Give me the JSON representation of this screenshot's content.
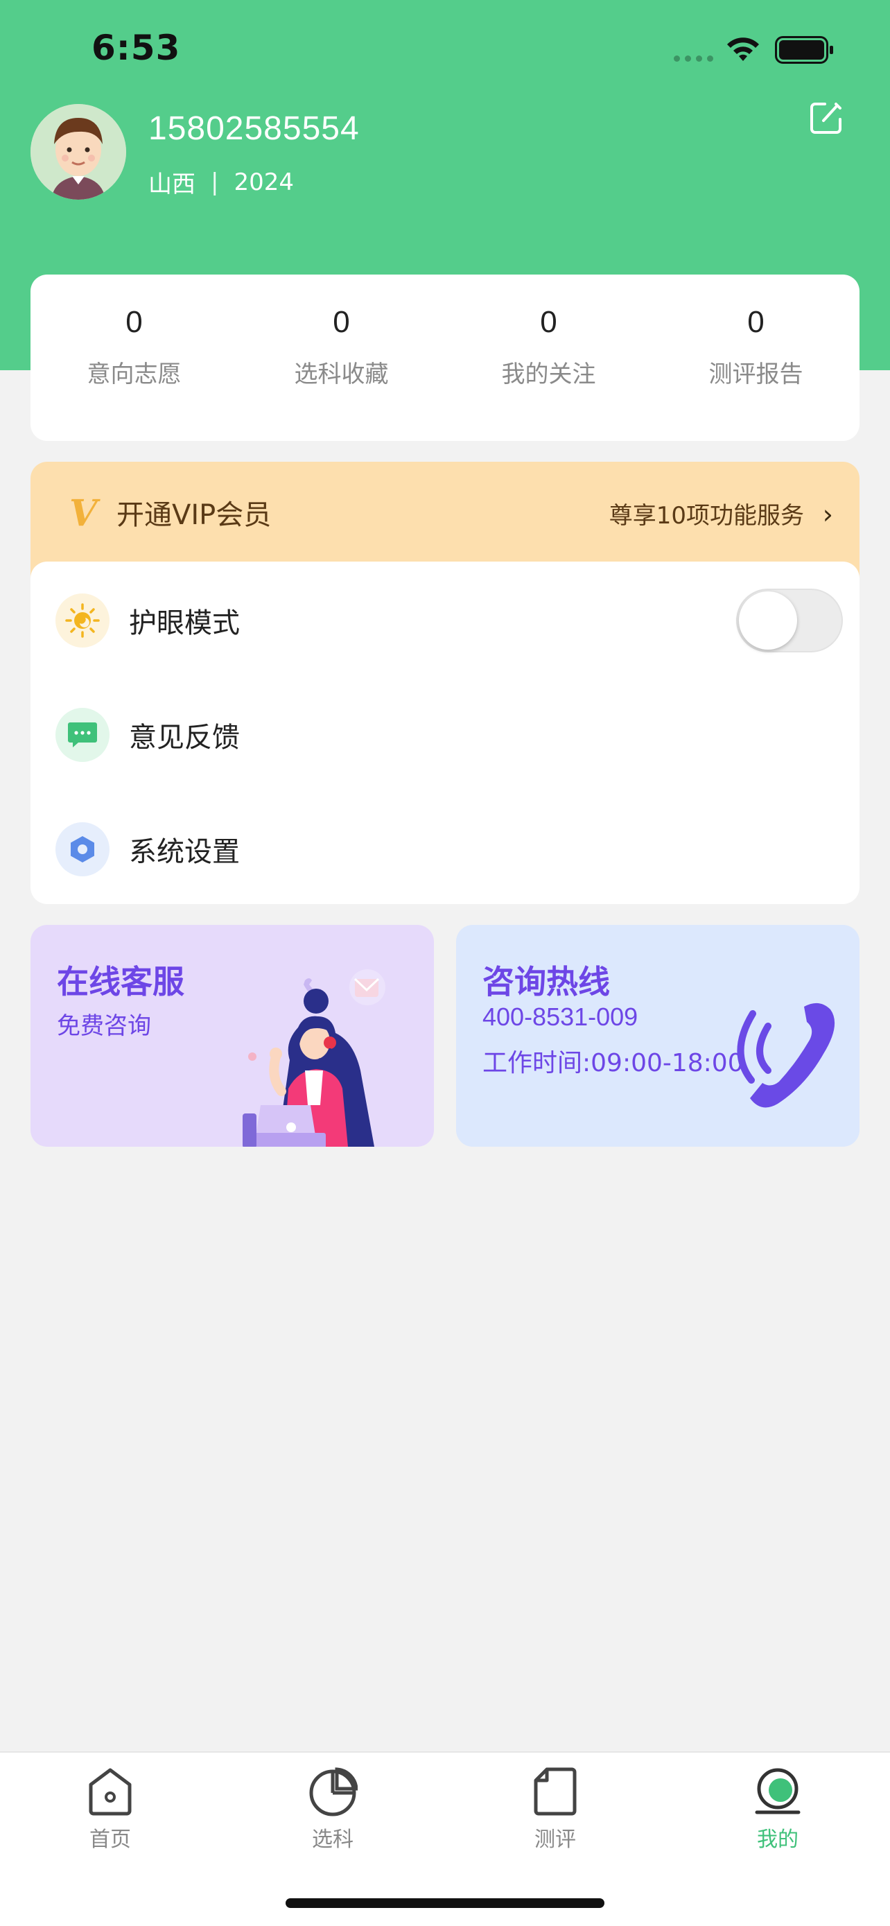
{
  "status_bar": {
    "time": "6:53"
  },
  "profile": {
    "phone": "15802585554",
    "region": "山西",
    "separator": "|",
    "year": "2024"
  },
  "stats": [
    {
      "value": "0",
      "label": "意向志愿"
    },
    {
      "value": "0",
      "label": "选科收藏"
    },
    {
      "value": "0",
      "label": "我的关注"
    },
    {
      "value": "0",
      "label": "测评报告"
    }
  ],
  "vip": {
    "logo": "V",
    "title": "开通VIP会员",
    "subtitle": "尊享10项功能服务",
    "chevron": "›"
  },
  "menu": [
    {
      "label": "护眼模式",
      "icon": "sun-icon",
      "toggle_on": false
    },
    {
      "label": "意见反馈",
      "icon": "feedback-icon"
    },
    {
      "label": "系统设置",
      "icon": "settings-icon"
    }
  ],
  "service_card": {
    "title": "在线客服",
    "subtitle": "免费咨询"
  },
  "hotline_card": {
    "title": "咨询热线",
    "number": "400-8531-009",
    "hours": "工作时间:09:00-18:00"
  },
  "tabbar": [
    {
      "label": "首页",
      "icon": "home-icon",
      "active": false
    },
    {
      "label": "选科",
      "icon": "pie-chart-icon",
      "active": false
    },
    {
      "label": "测评",
      "icon": "document-icon",
      "active": false
    },
    {
      "label": "我的",
      "icon": "profile-icon",
      "active": true
    }
  ],
  "colors": {
    "primary": "#54cd8b",
    "accent_purple": "#6d46e6",
    "vip_bg": "#fddfae",
    "active_tab": "#3fc17a"
  }
}
